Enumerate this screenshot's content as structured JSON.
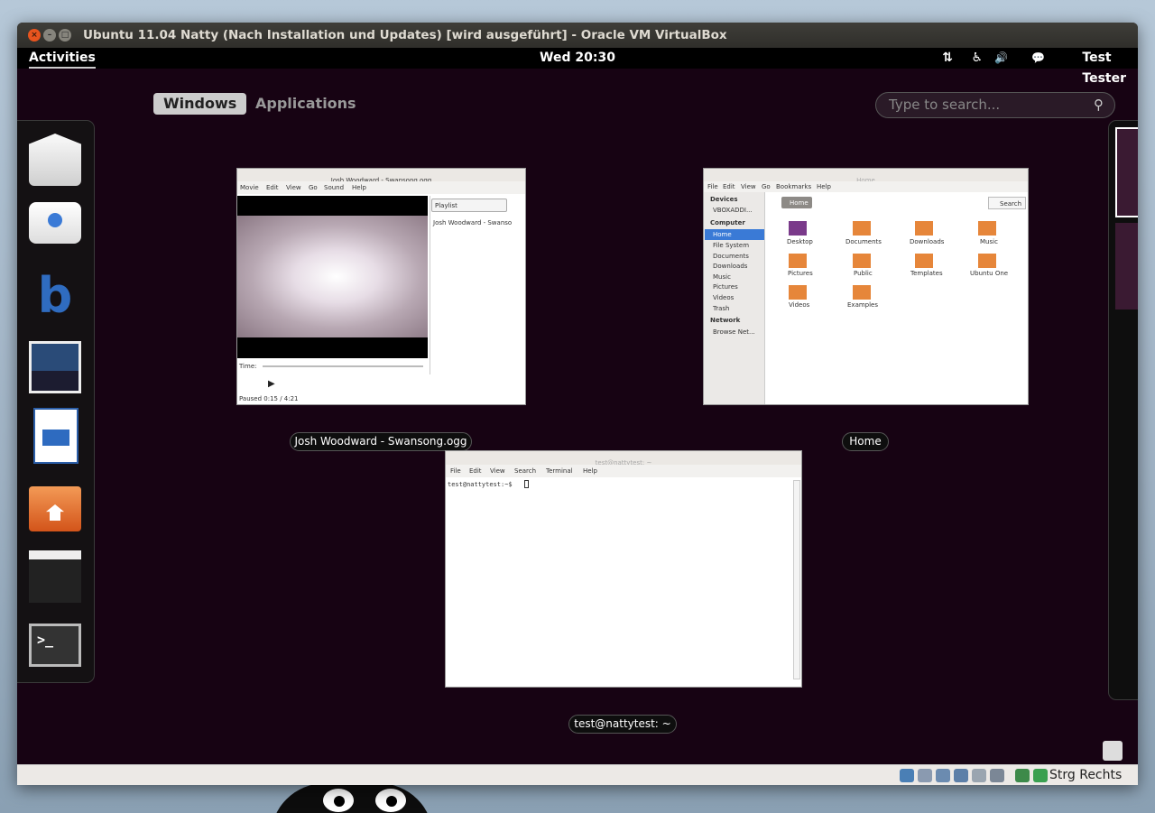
{
  "vbox": {
    "title": "Ubuntu 11.04 Natty (Nach Installation und Updates) [wird ausgeführt] - Oracle VM VirtualBox",
    "host_key": "Strg Rechts"
  },
  "topbar": {
    "activities": "Activities",
    "clock": "Wed 20:30",
    "user": "Test Tester"
  },
  "overview": {
    "tabs": [
      "Windows",
      "Applications"
    ],
    "search_placeholder": "Type to search..."
  },
  "dash": [
    "mail-icon",
    "chat-icon",
    "banshee-icon",
    "photos-icon",
    "writer-icon",
    "home-folder-icon",
    "movie-icon",
    "terminal-icon"
  ],
  "windows": [
    {
      "caption": "Josh Woodward - Swansong.ogg",
      "title": "Josh Woodward - Swansong.ogg",
      "menu": [
        "Movie",
        "Edit",
        "View",
        "Go",
        "Sound",
        "Help"
      ],
      "playlist_label": "Playlist",
      "playlist_item": "Josh Woodward - Swanso",
      "time_label": "Time:",
      "status": "Paused  0:15 / 4:21"
    },
    {
      "caption": "Home",
      "title": "Home",
      "menu": [
        "File",
        "Edit",
        "View",
        "Go",
        "Bookmarks",
        "Help"
      ],
      "location": "Home",
      "search_label": "Search",
      "sidebar": [
        "Devices",
        "VBOXADDI...",
        "Computer",
        "Home",
        "File System",
        "Documents",
        "Downloads",
        "Music",
        "Pictures",
        "Videos",
        "Trash",
        "Network",
        "Browse Net..."
      ],
      "folders": [
        "Desktop",
        "Documents",
        "Downloads",
        "Music",
        "Pictures",
        "Public",
        "Templates",
        "Ubuntu One",
        "Videos",
        "Examples"
      ]
    },
    {
      "caption": "test@nattytest: ~",
      "title": "test@nattytest: ~",
      "menu": [
        "File",
        "Edit",
        "View",
        "Search",
        "Terminal",
        "Help"
      ],
      "prompt": "test@nattytest:~$"
    }
  ],
  "colors": {
    "desktop": "#170313",
    "accent": "#e8541e"
  }
}
